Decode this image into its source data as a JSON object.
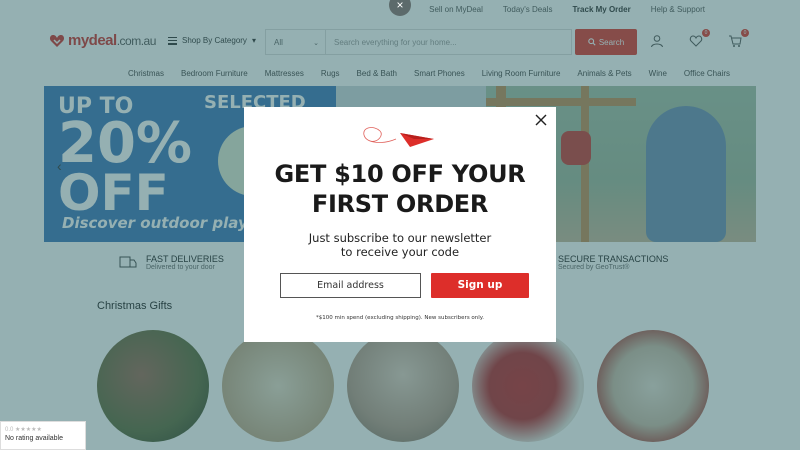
{
  "top_links": [
    "Sell on MyDeal",
    "Today's Deals",
    "Track My Order",
    "Help & Support"
  ],
  "logo": {
    "name": "mydeal",
    "domain": ".com.au"
  },
  "shop_by_category": "Shop By Category",
  "search": {
    "category": "All",
    "placeholder": "Search everything for your home...",
    "button": "Search"
  },
  "header_badges": {
    "wishlist": "0",
    "cart": "0"
  },
  "category_nav": [
    "Christmas",
    "Bedroom Furniture",
    "Mattresses",
    "Rugs",
    "Bed & Bath",
    "Smart Phones",
    "Living Room Furniture",
    "Animals & Pets",
    "Wine",
    "Office Chairs"
  ],
  "banner": {
    "up_to": "UP TO",
    "percent": "20%",
    "off": "OFF",
    "selected": "SELECTED",
    "discover": "Discover outdoor play"
  },
  "features": [
    {
      "title": "FAST DELIVERIES",
      "subtitle": "Delivered to your door"
    },
    {
      "title": "SECURE TRANSACTIONS",
      "subtitle": "Secured by GeoTrust®"
    }
  ],
  "section_title": "Christmas Gifts",
  "rating_widget": {
    "score": "0.0",
    "text": "No rating available"
  },
  "modal": {
    "headline_1": "GET $10 OFF YOUR",
    "headline_2": "FIRST ORDER",
    "sub_1": "Just subscribe to our newsletter",
    "sub_2": "to receive your code",
    "email_placeholder": "Email address",
    "signup": "Sign up",
    "fineprint": "*$100 min spend (excluding shipping). New subscribers only."
  },
  "colors": {
    "brand_red": "#dd2e2a",
    "overlay": "#2c6265"
  }
}
